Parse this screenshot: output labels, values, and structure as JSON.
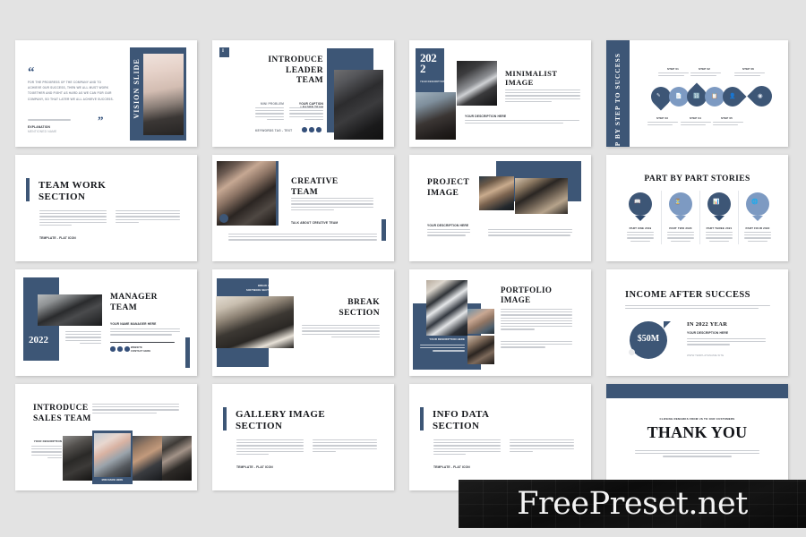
{
  "canvas": {
    "background_color": "#e3e3e3",
    "slide_background": "#ffffff",
    "accent_navy": "#3d5676",
    "accent_light_blue": "#7d9ac2"
  },
  "watermark": {
    "text": "FreePreset.net"
  },
  "slides": [
    {
      "id": "vision-slide",
      "title": "VISION SLIDE",
      "quote": "FOR THE PROGRESS OF THE COMPANY AND TO ACHIEVE OUR SUCCESS, THEN WE ALL MUST WORK TOGETHER AND FIGHT AS HARD AS WE CAN FOR OUR COMPANY, SO THAT LATER WE ALL ACHIEVE SUCCESS.",
      "caption_label": "Explanation",
      "caption_sub": "Mentioned name"
    },
    {
      "id": "introduce-leader-team",
      "title_lines": [
        "INTRODUCE",
        "LEADER",
        "TEAM"
      ],
      "col1_label": "Mini problem",
      "col2_label": "Your caption leader team",
      "footer_label": "Keywords tag - Text"
    },
    {
      "id": "minimalist-image",
      "title_lines": [
        "MINIMALIST",
        "IMAGE"
      ],
      "year": "2022",
      "year_sub": "Year description",
      "desc_label": "Your description here"
    },
    {
      "id": "step-by-step-to-success",
      "title": "STEP BY STEP TO SUCCESS",
      "steps": [
        {
          "label": "Step 01",
          "icon": "pen-icon"
        },
        {
          "label": "Step 02",
          "icon": "document-icon"
        },
        {
          "label": "Step 03",
          "icon": "calculator-icon"
        },
        {
          "label": "Step 04",
          "icon": "clipboard-icon"
        },
        {
          "label": "Step 05",
          "icon": "user-icon"
        },
        {
          "label": "Step 06",
          "icon": "target-icon"
        }
      ]
    },
    {
      "id": "team-work-section",
      "title_lines": [
        "TEAM WORK",
        "SECTION"
      ],
      "footer_label": "Template - Flat icon"
    },
    {
      "id": "creative-team",
      "title_lines": [
        "CREATIVE",
        "TEAM"
      ],
      "sub_label": "Talk about creative team"
    },
    {
      "id": "project-image",
      "title_lines": [
        "PROJECT",
        "IMAGE"
      ],
      "desc_label": "Your description here"
    },
    {
      "id": "part-by-part-stories",
      "title": "PART BY PART STORIES",
      "items": [
        {
          "label": "Part one 2019",
          "icon": "book-icon"
        },
        {
          "label": "Part two 2020",
          "icon": "clock-icon"
        },
        {
          "label": "Part three 2021",
          "icon": "chart-icon"
        },
        {
          "label": "Part four 2022",
          "icon": "globe-icon"
        }
      ]
    },
    {
      "id": "manager-team",
      "title_lines": [
        "MANAGER",
        "TEAM"
      ],
      "year": "2022",
      "sub_label": "Your name manager here",
      "contact_label": "Website\ncontact here"
    },
    {
      "id": "break-section",
      "title_lines": [
        "BREAK",
        "SECTION"
      ],
      "badge_label": "Break and\nsoftware section"
    },
    {
      "id": "portfolio-image",
      "title_lines": [
        "PORTFOLIO",
        "IMAGE"
      ],
      "panel_label": "Your description here"
    },
    {
      "id": "income-after-success",
      "title": "INCOME AFTER SUCCESS",
      "amount": "$50M",
      "sub_title": "IN 2022 YEAR",
      "desc_label": "Your description here",
      "link_label": "www.templatename.site"
    },
    {
      "id": "introduce-sales-team",
      "title_lines": [
        "INTRODUCE",
        "SALES TEAM"
      ],
      "side_label": "Your description",
      "card_label": "Mini name here"
    },
    {
      "id": "gallery-image-section",
      "title_lines": [
        "GALLERY IMAGE",
        "SECTION"
      ],
      "footer_label": "Template - Flat icon"
    },
    {
      "id": "info-data-section",
      "title_lines": [
        "INFO DATA",
        "SECTION"
      ],
      "footer_label": "Template - Flat icon"
    },
    {
      "id": "thank-you",
      "eyebrow": "CLOSING REMARKS FROM US TO OUR CUSTOMERS",
      "title": "THANK YOU"
    }
  ]
}
